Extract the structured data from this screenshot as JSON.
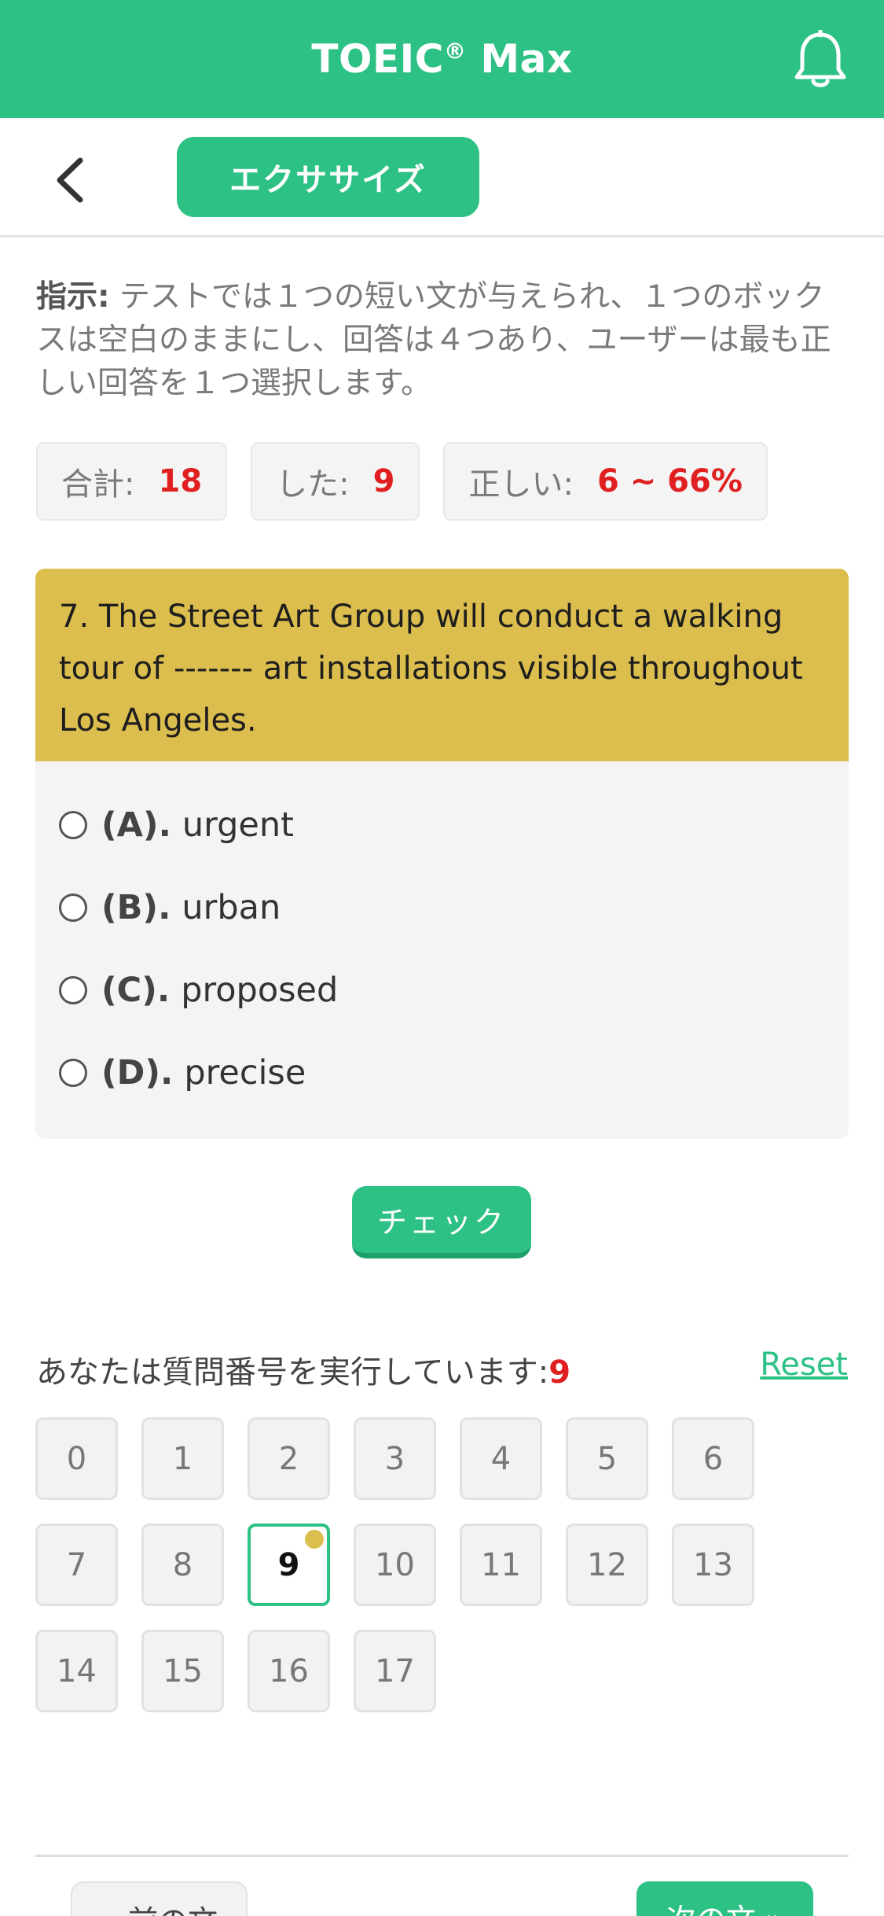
{
  "appbar": {
    "title": "TOEIC",
    "title_mark": "®",
    "title_suffix": " Max",
    "icon": "bell-icon"
  },
  "subheader": {
    "back_icon": "chevron-left-icon",
    "mode_label": "エクササイズ"
  },
  "instructions": {
    "label": "指示:",
    "text": " テストでは１つの短い文が与えられ、１つのボックスは空白のままにし、回答は４つあり、ユーザーは最も正しい回答を１つ選択します。"
  },
  "stats": {
    "total_label": "合計:",
    "total_value": "18",
    "done_label": "した:",
    "done_value": "9",
    "correct_label": "正しい:",
    "correct_value": "6 ~ 66%"
  },
  "question": {
    "text": "7. The Street Art Group will conduct a walking tour of ------- art installations visible throughout Los Angeles.",
    "options": [
      {
        "key": "(A).",
        "text": "urgent"
      },
      {
        "key": "(B).",
        "text": "urban"
      },
      {
        "key": "(C).",
        "text": "proposed"
      },
      {
        "key": "(D).",
        "text": "precise"
      }
    ]
  },
  "check_label": "チェック",
  "progress": {
    "label": "あなたは質問番号を実行しています:",
    "current": "9",
    "reset_label": "Reset",
    "numbers": [
      "0",
      "1",
      "2",
      "3",
      "4",
      "5",
      "6",
      "7",
      "8",
      "9",
      "10",
      "11",
      "12",
      "13",
      "14",
      "15",
      "16",
      "17"
    ]
  },
  "footer": {
    "prev_label": "« 前の文",
    "next_label": "次の文 »"
  },
  "colors": {
    "brand": "#2ec185",
    "question_header": "#dcbe4e",
    "highlight": "#e02020"
  }
}
